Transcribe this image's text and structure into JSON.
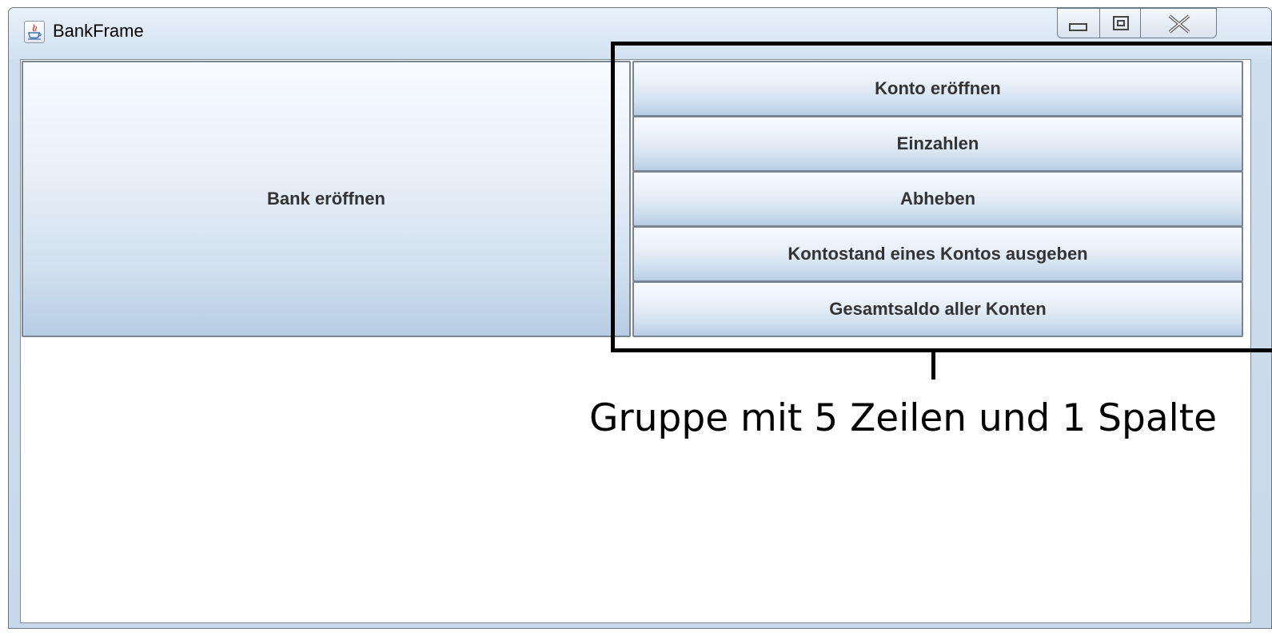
{
  "window": {
    "title": "BankFrame",
    "icon": "java-app-icon",
    "controls": {
      "minimize": "minimize-icon",
      "maximize": "maximize-icon",
      "close": "close-icon"
    }
  },
  "main": {
    "bank_button_label": "Bank eröffnen",
    "group_buttons": [
      {
        "label": "Konto eröffnen"
      },
      {
        "label": "Einzahlen"
      },
      {
        "label": "Abheben"
      },
      {
        "label": "Kontostand eines Kontos ausgeben"
      },
      {
        "label": "Gesamtsaldo aller Konten"
      }
    ]
  },
  "annotation": {
    "caption": "Gruppe mit 5 Zeilen und 1 Spalte"
  },
  "colors": {
    "button_top": "#f8fbfe",
    "button_bottom": "#b7cde4",
    "button_border": "#7a8594",
    "button_text": "#333333",
    "annotation": "#000000"
  }
}
